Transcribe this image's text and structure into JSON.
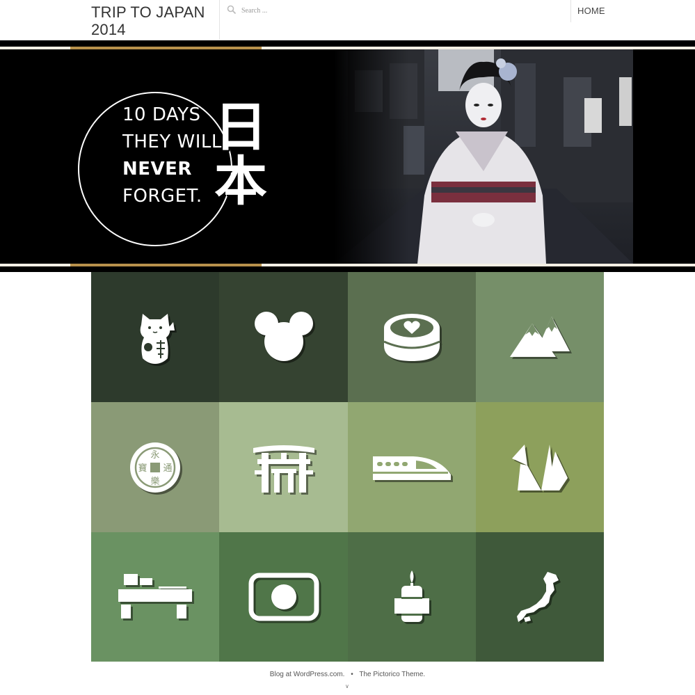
{
  "site": {
    "title": "TRIP TO JAPAN 2014"
  },
  "search": {
    "placeholder": "Search ..."
  },
  "nav": {
    "home": "HOME"
  },
  "banner": {
    "line1": "10 DAYS",
    "line2": "THEY WILL",
    "line3": "NEVER",
    "line4": "FORGET.",
    "kanji_1": "日",
    "kanji_2": "本"
  },
  "tiles": [
    {
      "icon": "maneki-neko-icon",
      "color": "#2d3a2c"
    },
    {
      "icon": "mickey-mouse-icon",
      "color": "#354331"
    },
    {
      "icon": "sushi-roll-icon",
      "color": "#5b6f50"
    },
    {
      "icon": "mountains-icon",
      "color": "#768f69"
    },
    {
      "icon": "coin-icon",
      "color": "#8a9a76"
    },
    {
      "icon": "torii-gate-icon",
      "color": "#a7bb91"
    },
    {
      "icon": "bullet-train-icon",
      "color": "#91a771"
    },
    {
      "icon": "paper-crane-icon",
      "color": "#8da05c"
    },
    {
      "icon": "tea-table-icon",
      "color": "#6a9262"
    },
    {
      "icon": "japan-flag-icon",
      "color": "#507649"
    },
    {
      "icon": "candle-icon",
      "color": "#4e6e47"
    },
    {
      "icon": "japan-map-icon",
      "color": "#3f593a"
    }
  ],
  "coin_text": "永口寶樂通",
  "footer": {
    "left": "Blog at WordPress.com.",
    "separator": "•",
    "right": "The Pictorico Theme."
  },
  "colors": {
    "gold": "#b8914b",
    "cream": "#f3efe4"
  }
}
